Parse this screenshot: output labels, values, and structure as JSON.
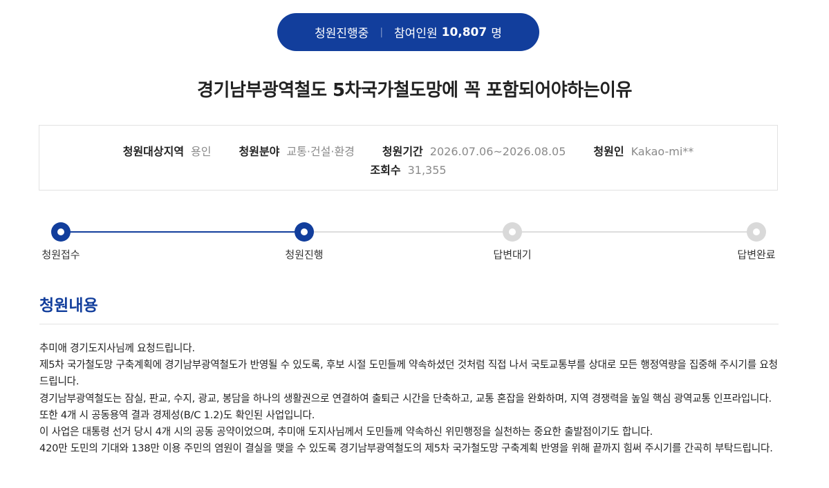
{
  "status": {
    "label": "청원진행중",
    "separator": "|",
    "participants_label": "참여인원",
    "participants_count": "10,807",
    "participants_unit": "명"
  },
  "title": "경기남부광역철도 5차국가철도망에 꼭 포함되어야하는이유",
  "info": {
    "region_label": "청원대상지역",
    "region_value": "용인",
    "field_label": "청원분야",
    "field_value": "교통·건설·환경",
    "period_label": "청원기간",
    "period_value": "2026.07.06~2026.08.05",
    "author_label": "청원인",
    "author_value": "Kakao-mi**",
    "views_label": "조회수",
    "views_value": "31,355"
  },
  "progress": {
    "steps": [
      {
        "label": "청원접수",
        "state": "active"
      },
      {
        "label": "청원진행",
        "state": "active"
      },
      {
        "label": "답변대기",
        "state": "pending"
      },
      {
        "label": "답변완료",
        "state": "pending"
      }
    ]
  },
  "section": {
    "title": "청원내용"
  },
  "content": {
    "paragraphs": [
      "추미애 경기도지사님께 요청드립니다.",
      "제5차 국가철도망 구축계획에 경기남부광역철도가 반영될 수 있도록, 후보 시절 도민들께 약속하셨던 것처럼 직접 나서 국토교통부를 상대로 모든 행정역량을 집중해 주시기를 요청드립니다.",
      "경기남부광역철도는 잠실, 판교, 수지, 광교, 봉담을 하나의 생활권으로 연결하여 출퇴근 시간을 단축하고, 교통 혼잡을 완화하며, 지역 경쟁력을 높일 핵심 광역교통 인프라입니다. 또한 4개 시 공동용역 결과 경제성(B/C 1.2)도 확인된 사업입니다.",
      "이 사업은 대통령 선거 당시 4개 시의 공동 공약이었으며, 추미애 도지사님께서 도민들께 약속하신 위민행정을 실천하는 중요한 출발점이기도 합니다.",
      "420만 도민의 기대와 138만 이용 주민의 염원이 결실을 맺을 수 있도록 경기남부광역철도의 제5차 국가철도망 구축계획 반영을 위해 끝까지 힘써 주시기를 간곡히 부탁드립니다."
    ]
  },
  "colors": {
    "accent": "#123e9c",
    "pending": "#d9d9d9",
    "muted_text": "#8a8a8a"
  }
}
